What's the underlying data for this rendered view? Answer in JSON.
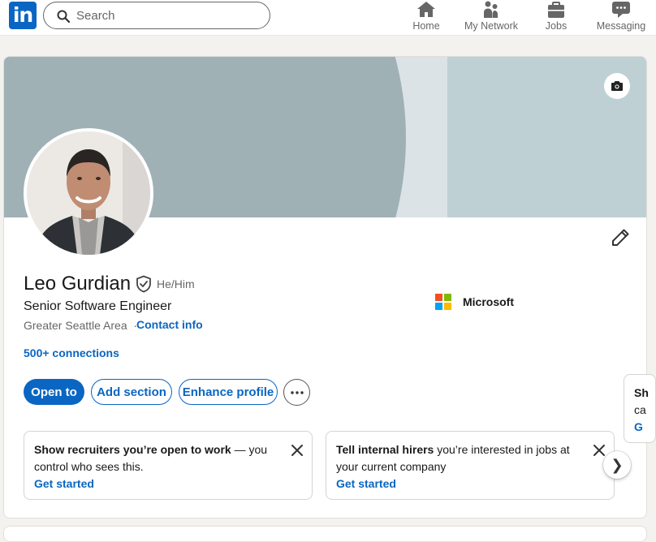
{
  "header": {
    "logo_text": "in",
    "search": {
      "placeholder": "Search"
    },
    "nav": [
      {
        "label": "Home",
        "icon": "home-icon"
      },
      {
        "label": "My Network",
        "icon": "network-icon"
      },
      {
        "label": "Jobs",
        "icon": "briefcase-icon"
      },
      {
        "label": "Messaging",
        "icon": "messaging-icon"
      }
    ]
  },
  "profile": {
    "name": "Leo Gurdian",
    "pronouns": "He/Him",
    "headline": "Senior Software Engineer",
    "location": "Greater Seattle Area",
    "location_sep": "·",
    "contact_info": "Contact info",
    "connections": "500+ connections",
    "company": "Microsoft"
  },
  "actions": {
    "open_to": "Open to",
    "add_section": "Add section",
    "enhance_profile": "Enhance profile"
  },
  "suggestions": [
    {
      "bold": "Show recruiters you’re open to work",
      "rest": " — you control who sees this.",
      "cta": "Get started"
    },
    {
      "bold": "Tell internal hirers",
      "rest": " you’re interested in jobs at your current company",
      "cta": "Get started"
    },
    {
      "bold": "Sh",
      "rest": "ca",
      "cta": "G"
    }
  ],
  "colors": {
    "brand": "#0a66c2",
    "cover_left": "#a0b1b6",
    "cover_mid": "#dbe3e6",
    "cover_right": "#bfd0d4"
  }
}
